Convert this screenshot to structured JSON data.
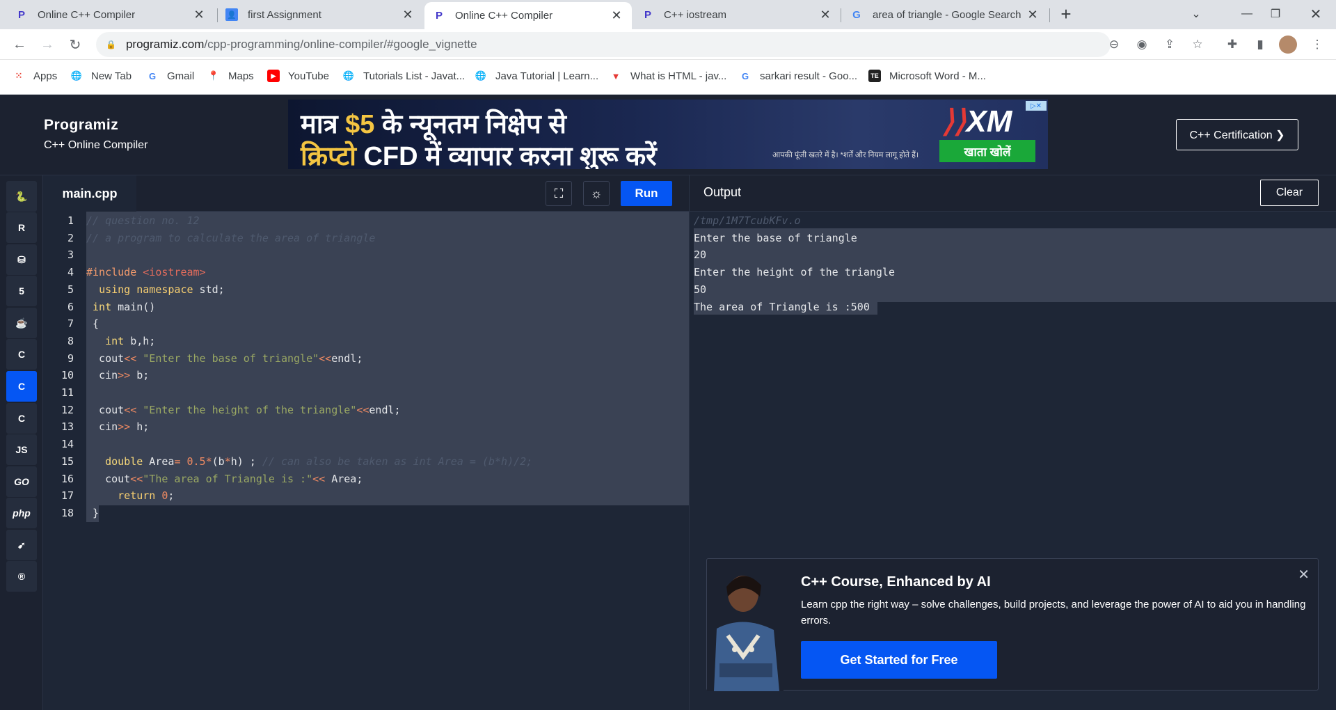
{
  "browser": {
    "tabs": [
      {
        "title": "Online C++ Compiler",
        "icon": "programiz-icon",
        "active": false
      },
      {
        "title": "first Assignment",
        "icon": "classroom-icon",
        "active": false
      },
      {
        "title": "Online C++ Compiler",
        "icon": "programiz-icon",
        "active": true
      },
      {
        "title": "C++ iostream",
        "icon": "programiz-icon",
        "active": false
      },
      {
        "title": "area of triangle - Google Search",
        "icon": "google-icon",
        "active": false
      }
    ],
    "new_tab_label": "+",
    "url_host": "programiz.com",
    "url_path": "/cpp-programming/online-compiler/#google_vignette",
    "bookmarks": [
      {
        "label": "Apps"
      },
      {
        "label": "New Tab"
      },
      {
        "label": "Gmail"
      },
      {
        "label": "Maps"
      },
      {
        "label": "YouTube"
      },
      {
        "label": "Tutorials List - Javat..."
      },
      {
        "label": "Java Tutorial | Learn..."
      },
      {
        "label": "What is HTML - jav..."
      },
      {
        "label": "sarkari result - Goo..."
      },
      {
        "label": "Microsoft Word - M..."
      }
    ]
  },
  "site": {
    "logo": "Programiz",
    "subtitle": "C++ Online Compiler",
    "certification_button": "C++ Certification ❯",
    "ad": {
      "line1_pre": "मात्र ",
      "line1_amount": "$5",
      "line1_post": " के न्यूनतम निक्षेप से",
      "line2_crypto": "क्रिप्टो",
      "line2_post": " CFD में  व्यापार करना शुरू करें",
      "brand": "XM",
      "disclaimer": "आपकी पूंजी खतरे में है। *शर्तें और नियम लागू होते हैं।",
      "cta": "खाता खोलें"
    }
  },
  "languages": [
    "python-icon",
    "r-icon",
    "sql-icon",
    "html5-icon",
    "java-icon",
    "c-icon",
    "cpp-icon",
    "csharp-icon",
    "JS",
    "GO",
    "php",
    "swift-icon",
    "rust-icon"
  ],
  "editor": {
    "filename": "main.cpp",
    "run_label": "Run",
    "lines": [
      {
        "n": "1",
        "html": "<span class='cm'>// question no. 12</span>"
      },
      {
        "n": "2",
        "html": "<span class='cm'>// a program to calculate the area of triangle</span>"
      },
      {
        "n": "3",
        "html": ""
      },
      {
        "n": "4",
        "html": "<span class='pp'>#include</span> <span class='inc'>&lt;iostream&gt;</span>"
      },
      {
        "n": "5",
        "html": "  <span class='kw'>using</span> <span class='kw'>namespace</span> std;"
      },
      {
        "n": "6",
        "html": " <span class='typ'>int</span> main()"
      },
      {
        "n": "7",
        "html": " {"
      },
      {
        "n": "8",
        "html": "   <span class='typ'>int</span> b,h;"
      },
      {
        "n": "9",
        "html": "  cout<span class='op'>&lt;&lt;</span> <span class='str'>\"Enter the base of triangle\"</span><span class='op'>&lt;&lt;</span>endl;"
      },
      {
        "n": "10",
        "html": "  cin<span class='op'>&gt;&gt;</span> b;"
      },
      {
        "n": "11",
        "html": ""
      },
      {
        "n": "12",
        "html": "  cout<span class='op'>&lt;&lt;</span> <span class='str'>\"Enter the height of the triangle\"</span><span class='op'>&lt;&lt;</span>endl;"
      },
      {
        "n": "13",
        "html": "  cin<span class='op'>&gt;&gt;</span> h;"
      },
      {
        "n": "14",
        "html": ""
      },
      {
        "n": "15",
        "html": "   <span class='typ'>double</span> Area<span class='op'>=</span> <span class='num'>0.5</span><span class='op'>*</span>(b<span class='op'>*</span>h) ; <span class='cm'>// can also be taken as int Area = (b*h)/2;</span>"
      },
      {
        "n": "16",
        "html": "   cout<span class='op'>&lt;&lt;</span><span class='str'>\"The area of Triangle is :\"</span><span class='op'>&lt;&lt;</span> Area;"
      },
      {
        "n": "17",
        "html": "     <span class='kw'>return</span> <span class='num'>0</span>;"
      },
      {
        "n": "18",
        "html": " }"
      }
    ]
  },
  "output": {
    "title": "Output",
    "clear_label": "Clear",
    "lines": [
      {
        "text": "/tmp/1M7TcubKFv.o",
        "dim": true
      },
      {
        "text": "Enter the base of triangle",
        "dim": false
      },
      {
        "text": "20",
        "dim": false
      },
      {
        "text": "Enter the height of the triangle",
        "dim": false
      },
      {
        "text": "50",
        "dim": false
      },
      {
        "text": "The area of Triangle is :500",
        "dim": false
      }
    ]
  },
  "promo": {
    "title": "C++ Course, Enhanced by AI",
    "description": "Learn cpp the right way – solve challenges, build projects, and leverage the power of AI to aid you in handling errors.",
    "cta": "Get Started for Free",
    "close": "✕"
  },
  "colors": {
    "accent": "#0556f3",
    "bg": "#1e2636",
    "panel": "#1c2230"
  }
}
